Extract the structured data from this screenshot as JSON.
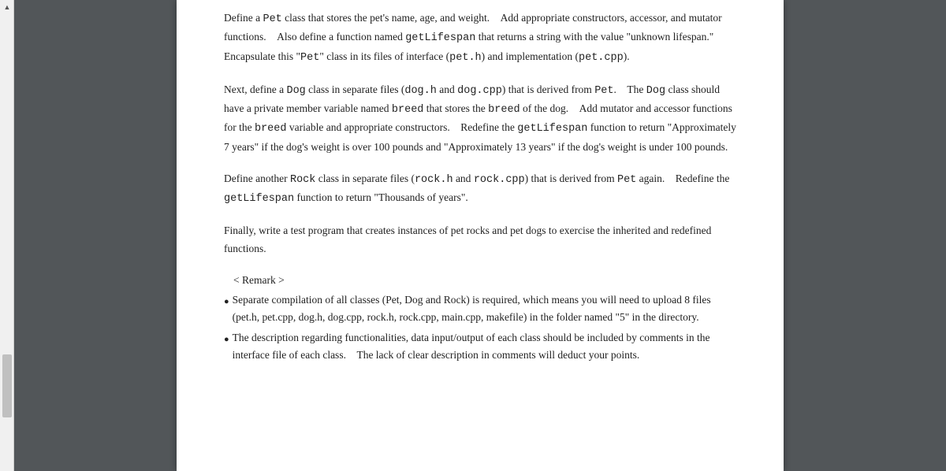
{
  "para1": {
    "t1": "Define a ",
    "c1": "Pet",
    "t2": " class that stores the pet's name, age, and weight. Add appropriate constructors, accessor, and mutator functions. Also define a function named ",
    "c2": "getLifespan",
    "t3": " that returns a string with the value \"unknown lifespan.\" Encapsulate this \"",
    "c3": "Pet",
    "t4": "\" class in its files of interface (",
    "c4": "pet.h",
    "t5": ") and implementation (",
    "c5": "pet.cpp",
    "t6": ")."
  },
  "para2": {
    "t1": "Next, define a ",
    "c1": "Dog",
    "t2": " class in separate files (",
    "c2": "dog.h",
    "t3": " and ",
    "c3": "dog.cpp",
    "t4": ") that is derived from ",
    "c4": "Pet",
    "t5": ". The ",
    "c5": "Dog",
    "t6": " class should have a private member variable named ",
    "c6": "breed",
    "t7": " that stores the ",
    "c7": "breed",
    "t8": " of the dog. Add mutator and accessor functions for the ",
    "c8": "breed",
    "t9": " variable and appropriate constructors. Redefine the ",
    "c9": "getLifespan",
    "t10": " function to return \"Approximately 7 years\" if the dog's weight is over 100 pounds and \"Approximately 13 years\" if the dog's weight is under 100 pounds."
  },
  "para3": {
    "t1": "Define another ",
    "c1": "Rock",
    "t2": " class in separate files (",
    "c2": "rock.h",
    "t3": " and ",
    "c3": "rock.cpp",
    "t4": ") that is derived from ",
    "c4": "Pet",
    "t5": "  again. Redefine the ",
    "c5": "getLifespan",
    "t6": " function to return \"Thousands of years\"."
  },
  "para4": {
    "t1": "Finally, write a test program that creates instances of pet rocks and pet dogs to exercise the inherited and redefined functions."
  },
  "remark": {
    "heading": "< Remark >",
    "b1": "Separate compilation of all classes (Pet, Dog and Rock) is required, which means you will need to upload 8 files (pet.h, pet.cpp, dog.h, dog.cpp, rock.h, rock.cpp, main.cpp, makefile) in the folder named \"5\" in the directory.",
    "b2": "The description regarding functionalities, data input/output of each class should be included by comments in the interface file of each class. The lack of clear description in comments will deduct your points."
  },
  "bullet_glyph": "●"
}
